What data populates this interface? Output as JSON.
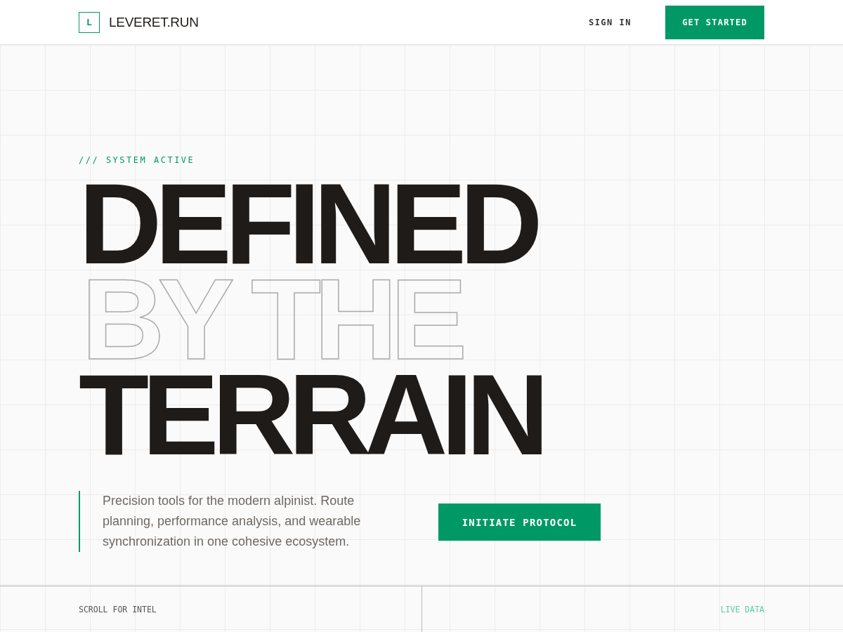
{
  "header": {
    "logo_mark": "L",
    "logo_text": "LEVERET.RUN",
    "sign_in": "SIGN IN",
    "cta": "GET STARTED"
  },
  "hero": {
    "eyebrow": "/// SYSTEM ACTIVE",
    "headline": [
      {
        "text": "DEFINED",
        "kind": "solid"
      },
      {
        "text": "BY THE",
        "kind": "outline"
      },
      {
        "text": "TERRAIN",
        "kind": "solid"
      }
    ],
    "description": "Precision tools for the modern alpinist. Route planning, performance analysis, and wearable synchronization in one cohesive ecosystem.",
    "button": "INITIATE PROTOCOL"
  },
  "footer_bar": {
    "left": "SCROLL FOR INTEL",
    "right": "LIVE DATA"
  }
}
